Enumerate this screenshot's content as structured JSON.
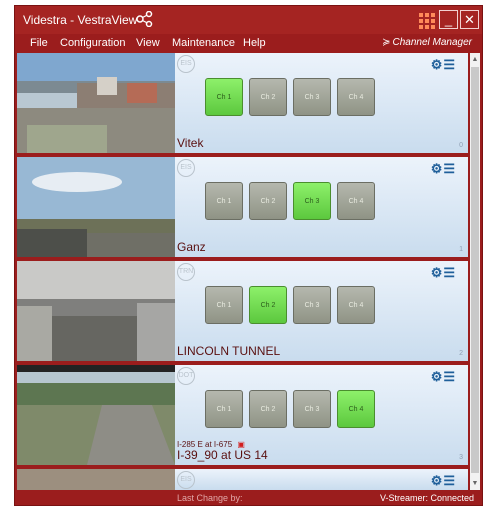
{
  "window": {
    "title": "Videstra - VestraView",
    "minimize": "_",
    "close": "✕"
  },
  "menu": [
    "File",
    "Configuration",
    "View",
    "Maintenance",
    "Help"
  ],
  "channel_manager": "Channel Manager",
  "channels": [
    "Ch 1",
    "Ch 2",
    "Ch 3",
    "Ch 4"
  ],
  "cameras": [
    {
      "name": "Vitek",
      "index": "0",
      "active": 1
    },
    {
      "name": "Ganz",
      "index": "1",
      "active": 3
    },
    {
      "name": "LINCOLN TUNNEL",
      "index": "2",
      "active": 2
    },
    {
      "name": "I-39_90 at US 14",
      "subtitle": "I-285 E at I-675",
      "index": "3",
      "active": 4
    }
  ],
  "status": {
    "left": "Last Change by:",
    "right": "V-Streamer: Connected"
  },
  "colors": {
    "frame": "#9b1d1d",
    "channel_on": "#68d84c",
    "channel_off": "#a3a69a"
  },
  "icons": [
    "share-icon",
    "app-grid-icon",
    "gear-icon",
    "list-icon"
  ]
}
